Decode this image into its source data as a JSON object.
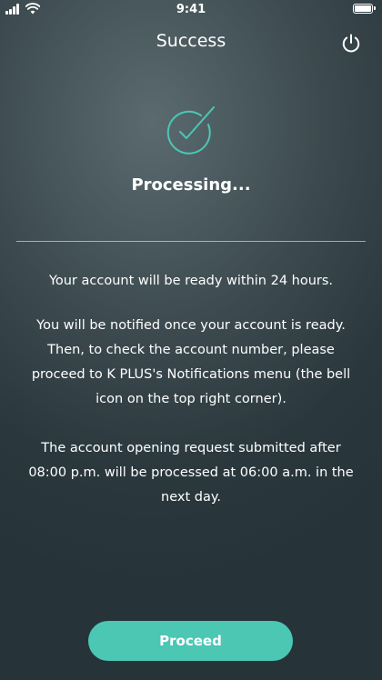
{
  "status_bar": {
    "time": "9:41"
  },
  "header": {
    "title": "Success",
    "power_icon": "power-icon"
  },
  "status": {
    "icon": "check-circle-icon",
    "label": "Processing..."
  },
  "content": {
    "paragraph_1": "Your account will be ready within 24 hours.",
    "paragraph_2": "You will be notified once your account is ready. Then, to check the account number, please proceed to K PLUS's Notifications menu (the bell icon on the top right corner).",
    "paragraph_3": "The account opening request submitted after 08:00 p.m. will be processed at 06:00 a.m. in the next day."
  },
  "actions": {
    "proceed_label": "Proceed"
  },
  "colors": {
    "accent": "#4bc7b4",
    "background_dark": "#26343a",
    "background_light": "#5a6a6e"
  }
}
